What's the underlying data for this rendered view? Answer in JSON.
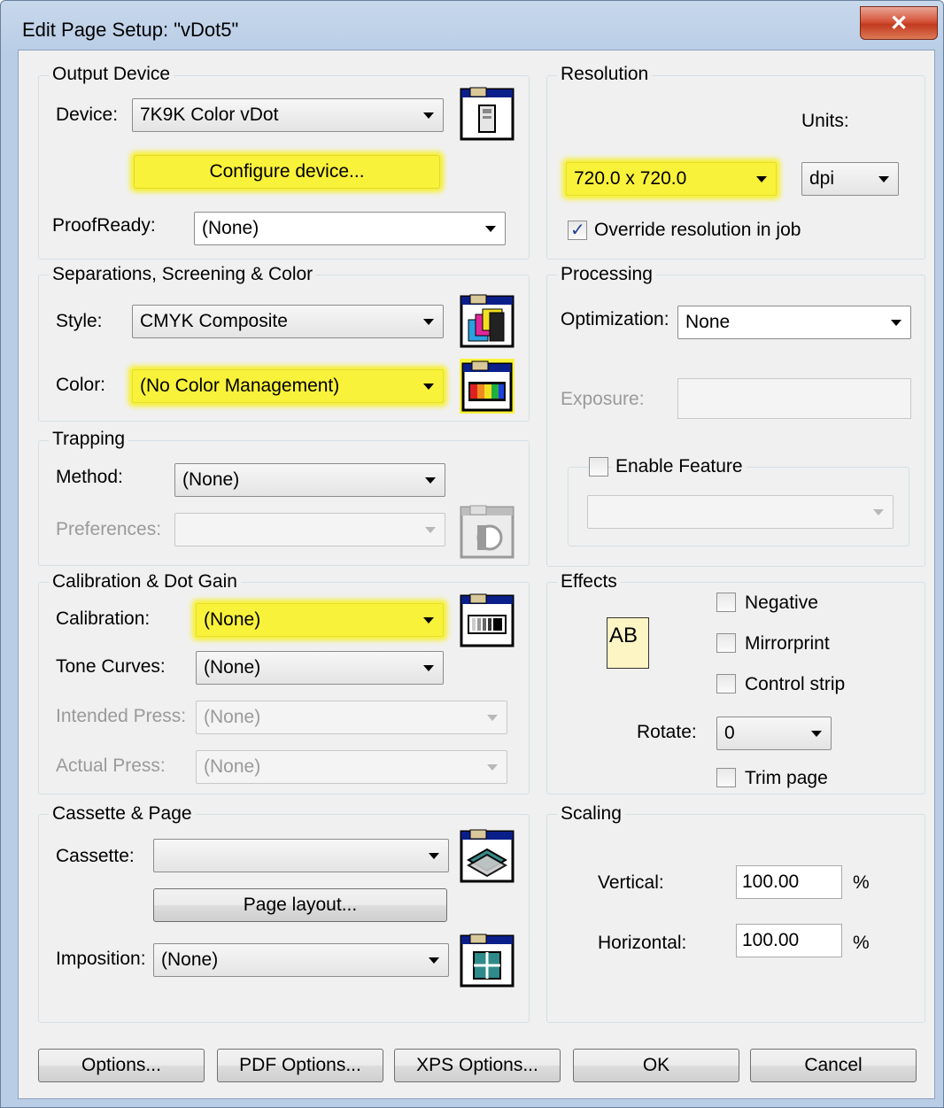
{
  "window": {
    "title": "Edit Page Setup: \"vDot5\"",
    "close_glyph": "✕"
  },
  "output_device": {
    "group_label": "Output Device",
    "device_label": "Device:",
    "device_value": "7K9K Color vDot",
    "configure_label": "Configure device...",
    "proofready_label": "ProofReady:",
    "proofready_value": "(None)"
  },
  "resolution": {
    "group_label": "Resolution",
    "units_label": "Units:",
    "resolution_value": "720.0 x 720.0",
    "units_value": "dpi",
    "override_label": "Override resolution in job",
    "override_checked": true
  },
  "separations": {
    "group_label": "Separations, Screening & Color",
    "style_label": "Style:",
    "style_value": "CMYK Composite",
    "color_label": "Color:",
    "color_value": "(No Color Management)"
  },
  "processing": {
    "group_label": "Processing",
    "optimization_label": "Optimization:",
    "optimization_value": "None",
    "exposure_label": "Exposure:",
    "exposure_value": "",
    "enable_feature_label": "Enable Feature",
    "feature_value": ""
  },
  "trapping": {
    "group_label": "Trapping",
    "method_label": "Method:",
    "method_value": "(None)",
    "preferences_label": "Preferences:",
    "preferences_value": ""
  },
  "calibration": {
    "group_label": "Calibration & Dot Gain",
    "calibration_label": "Calibration:",
    "calibration_value": "(None)",
    "tone_label": "Tone Curves:",
    "tone_value": "(None)",
    "intended_label": "Intended Press:",
    "intended_value": "(None)",
    "actual_label": "Actual Press:",
    "actual_value": "(None)"
  },
  "effects": {
    "group_label": "Effects",
    "ab_text": "AB",
    "negative_label": "Negative",
    "mirrorprint_label": "Mirrorprint",
    "control_strip_label": "Control strip",
    "rotate_label": "Rotate:",
    "rotate_value": "0",
    "trim_label": "Trim page"
  },
  "cassette": {
    "group_label": "Cassette & Page",
    "cassette_label": "Cassette:",
    "cassette_value": "",
    "page_layout_label": "Page layout...",
    "imposition_label": "Imposition:",
    "imposition_value": "(None)"
  },
  "scaling": {
    "group_label": "Scaling",
    "vertical_label": "Vertical:",
    "vertical_value": "100.00",
    "horizontal_label": "Horizontal:",
    "horizontal_value": "100.00",
    "percent": "%"
  },
  "buttons": {
    "options": "Options...",
    "pdf_options": "PDF Options...",
    "xps_options": "XPS Options...",
    "ok": "OK",
    "cancel": "Cancel"
  },
  "highlight_color": "#f9f23a"
}
